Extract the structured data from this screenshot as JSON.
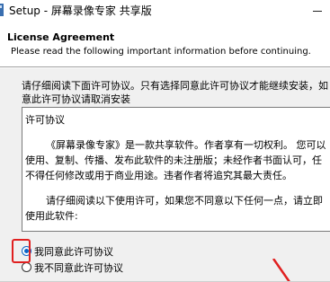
{
  "window": {
    "title": "Setup - 屏幕录像专家 共享版"
  },
  "header": {
    "title": "License Agreement",
    "subtitle": "Please read the following important information before continuing."
  },
  "instruction": {
    "line1": "请仔细阅读下面许可协议。只有选择同意此许可协议才能继续安装，如",
    "line2": "意此许可协议请取消安装"
  },
  "license": {
    "heading": "许可协议",
    "para1_l1": "《屏幕录像专家》是一款共享软件。作者享有一切权利。 您可以",
    "para1_l2": "使用、复制、传播、发布此软件的未注册版；未经作者书面认可，任",
    "para1_l3": "不得任何修改或用于商业用途。违者作者将追究其最大责任。",
    "para2_l1": "请仔细阅读以下使用许可，如果您不同意以下任何一点，请立即",
    "para2_l2": "使用此软件:"
  },
  "options": {
    "accept_label": "我同意此许可协议",
    "decline_label": "我不同意此许可协议",
    "selected": "accept"
  },
  "colors": {
    "highlight": "#e02020",
    "radio_accent": "#0a64c8"
  }
}
